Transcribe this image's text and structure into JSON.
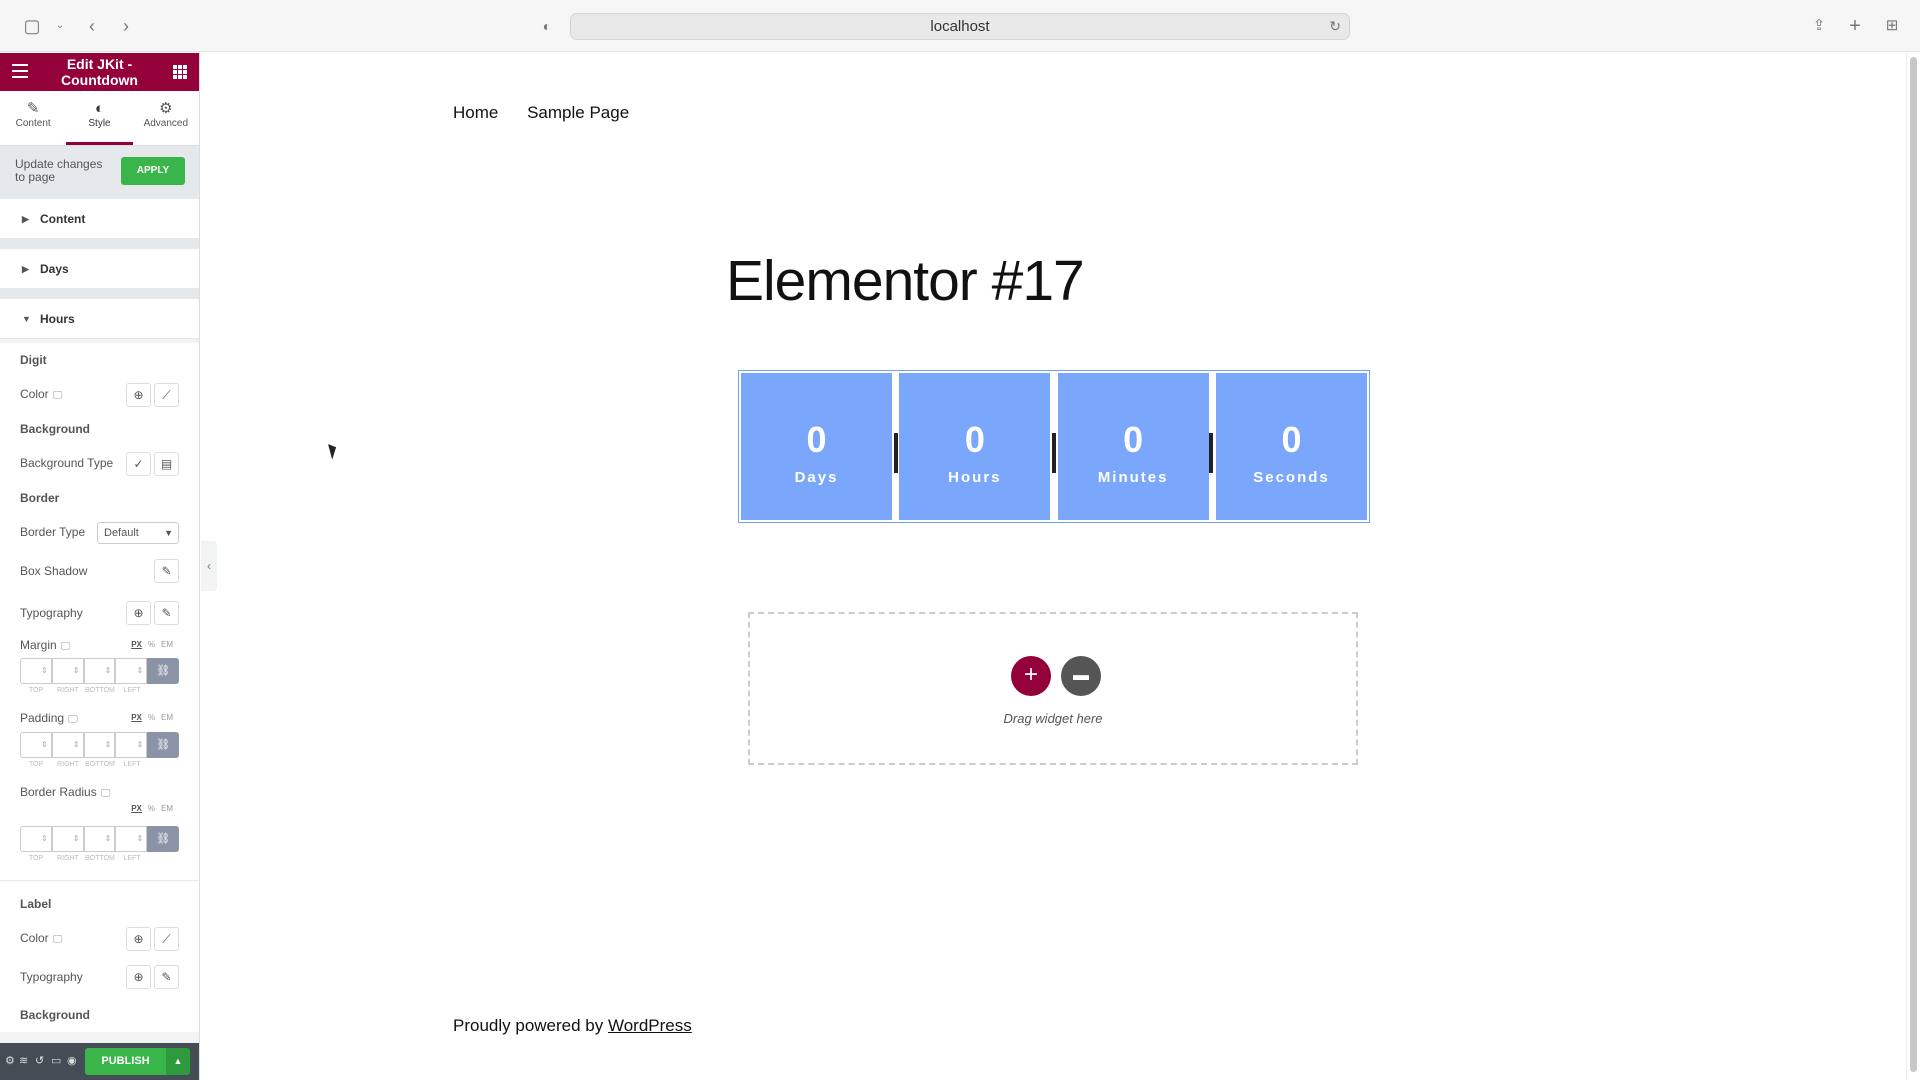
{
  "browser": {
    "url": "localhost"
  },
  "sidebar": {
    "title": "Edit JKit - Countdown",
    "tabs": [
      {
        "label": "Content"
      },
      {
        "label": "Style"
      },
      {
        "label": "Advanced"
      }
    ],
    "apply": {
      "message": "Update changes to page",
      "button": "APPLY"
    },
    "sections": [
      {
        "label": "Content"
      },
      {
        "label": "Days"
      },
      {
        "label": "Hours"
      }
    ],
    "hours": {
      "digit_heading": "Digit",
      "color_label": "Color",
      "background_heading": "Background",
      "background_type_label": "Background Type",
      "border_heading": "Border",
      "border_type_label": "Border Type",
      "border_type_value": "Default",
      "box_shadow_label": "Box Shadow",
      "typography_label": "Typography",
      "margin_label": "Margin",
      "padding_label": "Padding",
      "border_radius_label": "Border Radius",
      "unit_px": "PX",
      "unit_pct": "%",
      "unit_em": "EM",
      "dim_top": "TOP",
      "dim_right": "RIGHT",
      "dim_bottom": "BOTTOM",
      "dim_left": "LEFT",
      "label_heading": "Label",
      "label_color_label": "Color",
      "label_typography_label": "Typography",
      "label_background_heading": "Background"
    },
    "footer": {
      "publish": "PUBLISH"
    }
  },
  "page": {
    "nav": [
      "Home",
      "Sample Page"
    ],
    "title": "Elementor #17",
    "countdown": [
      {
        "num": "0",
        "label": "Days"
      },
      {
        "num": "0",
        "label": "Hours"
      },
      {
        "num": "0",
        "label": "Minutes"
      },
      {
        "num": "0",
        "label": "Seconds"
      }
    ],
    "dropzone_text": "Drag widget here",
    "powered_prefix": "Proudly powered by ",
    "powered_link": "WordPress"
  },
  "colors": {
    "elementor_brand": "#93003a",
    "apply_green": "#39b54a",
    "countdown_blue": "#7aa7fb"
  }
}
